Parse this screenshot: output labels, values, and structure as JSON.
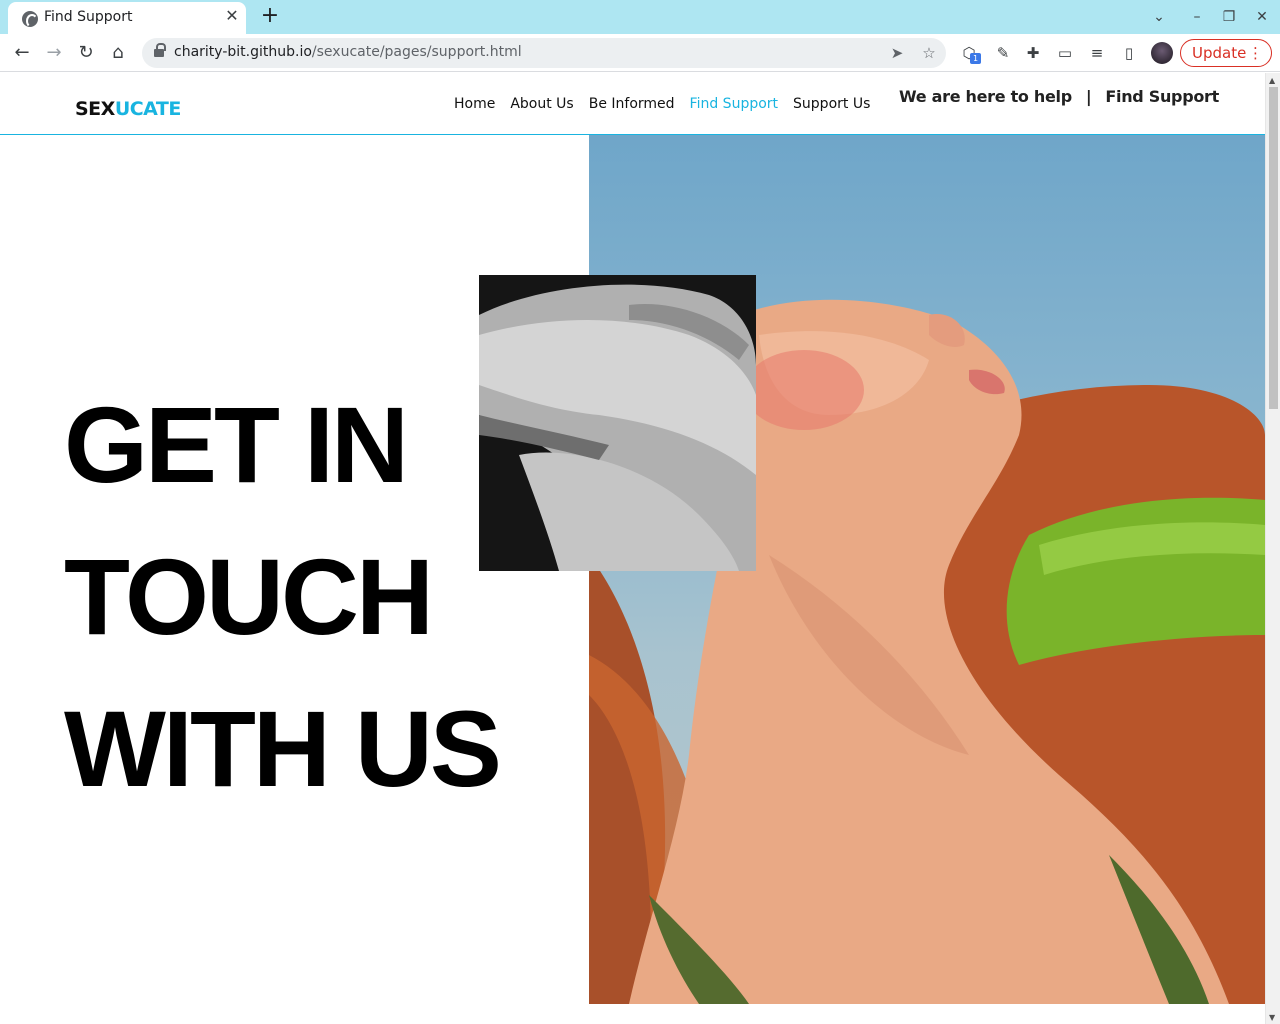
{
  "browser": {
    "tab_title": "Find Support",
    "url_host": "charity-bit.github.io",
    "url_path": "/sexucate/pages/support.html",
    "update_label": "Update",
    "extension_badge": "1"
  },
  "site": {
    "logo_part1": "SEX",
    "logo_part2": "UCATE",
    "nav": [
      {
        "label": "Home"
      },
      {
        "label": "About Us"
      },
      {
        "label": "Be Informed"
      },
      {
        "label": "Find Support"
      },
      {
        "label": "Support Us"
      }
    ],
    "tagline_left": "We are here to help",
    "tagline_sep": "|",
    "tagline_right": "Find Support"
  },
  "hero": {
    "line1": "GET IN",
    "line2": "TOUCH",
    "line3": "WITH US"
  },
  "colors": {
    "accent": "#19b4e0",
    "tabbar": "#aee6f2",
    "update_red": "#d93025"
  }
}
